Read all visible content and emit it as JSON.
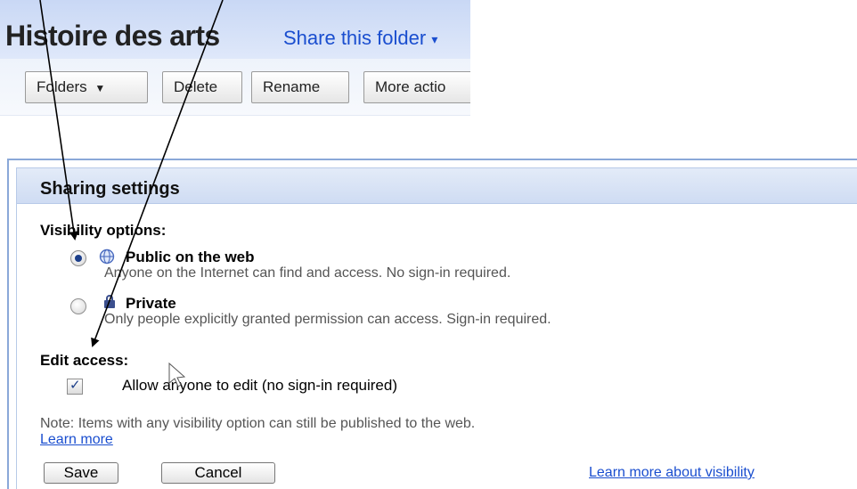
{
  "header": {
    "folder_title": "Histoire des arts",
    "share_label": "Share this folder"
  },
  "toolbar": {
    "folders_label": "Folders",
    "delete_label": "Delete",
    "rename_label": "Rename",
    "more_actions_label": "More actio"
  },
  "dialog": {
    "title": "Sharing settings",
    "visibility_label": "Visibility options:",
    "options": [
      {
        "title": "Public on the web",
        "description": "Anyone on the Internet can find and access. No sign-in required.",
        "selected": true,
        "icon": "globe-icon"
      },
      {
        "title": "Private",
        "description": "Only people explicitly granted permission can access. Sign-in required.",
        "selected": false,
        "icon": "lock-icon"
      }
    ],
    "edit_access_label": "Edit access:",
    "allow_edit": {
      "label": "Allow anyone to edit (no sign-in required)",
      "checked": true
    },
    "note": "Note: Items with any visibility option can still be published to the web.",
    "learn_more": "Learn more",
    "save_label": "Save",
    "cancel_label": "Cancel",
    "visibility_link": "Learn more about visibility"
  },
  "colors": {
    "link": "#1a4ecf",
    "header_band": "#c9d8f5",
    "dialog_border": "#8aa8d8"
  }
}
